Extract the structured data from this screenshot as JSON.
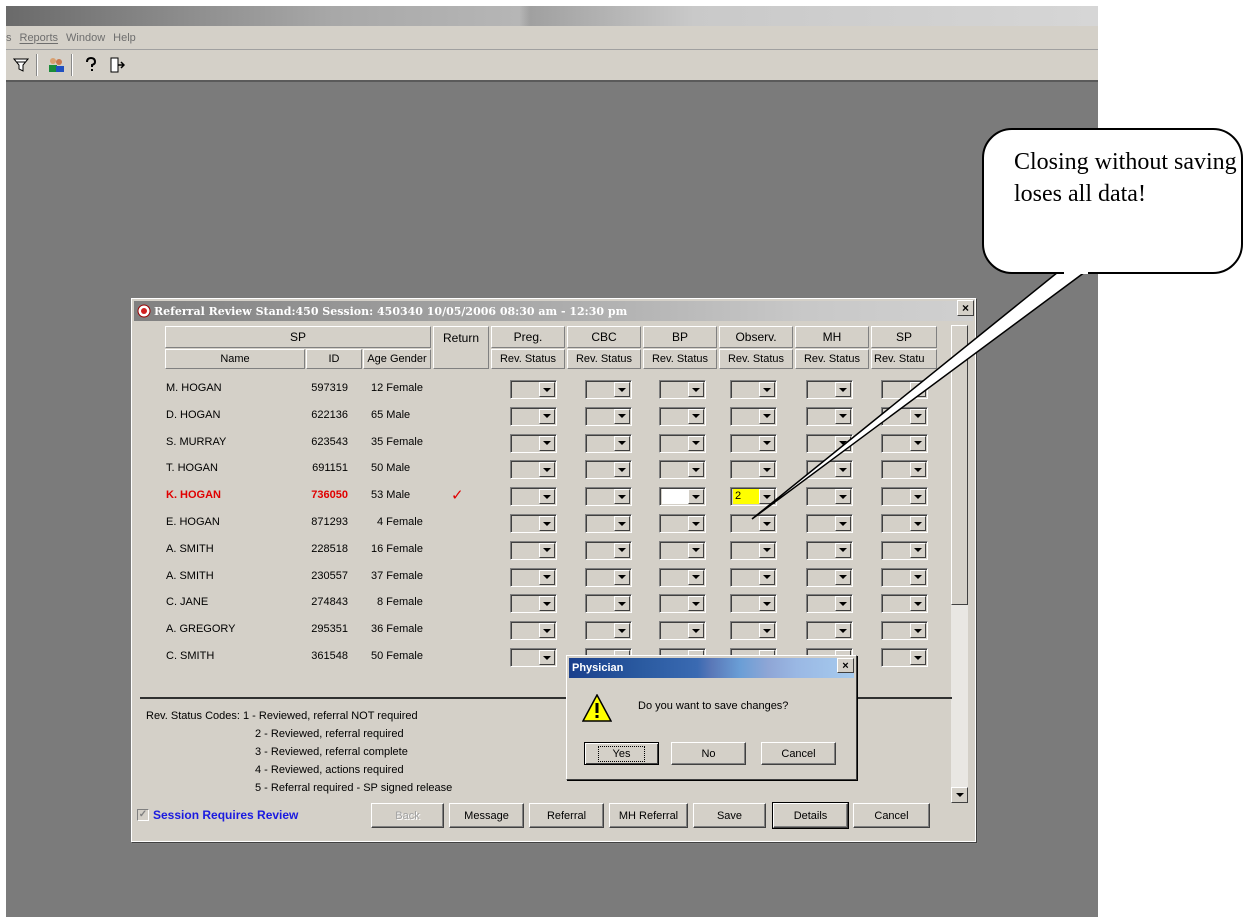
{
  "menubar": {
    "items": [
      "s",
      "Reports",
      "Window",
      "Help"
    ]
  },
  "toolbar": {
    "icons": [
      "filter-icon",
      "users-icon",
      "help-icon",
      "exit-icon"
    ]
  },
  "window": {
    "title": "Referral Review Stand:450 Session: 450340 10/05/2006 08:30 am - 12:30 pm",
    "close": "×",
    "headers": {
      "sp": "SP",
      "name": "Name",
      "id": "ID",
      "age_gender": "Age Gender",
      "return": "Return",
      "groups": [
        "Preg.",
        "CBC",
        "BP",
        "Observ.",
        "MH",
        "SP"
      ],
      "rev_status": [
        "Rev. Status",
        "Rev. Status",
        "Rev. Status",
        "Rev. Status",
        "Rev. Status",
        "Rev. Statu"
      ]
    },
    "rows": [
      {
        "name": "M. HOGAN",
        "id": "597319",
        "age_gender": "12 Female",
        "return": "",
        "values": [
          "",
          "",
          "",
          "",
          "",
          ""
        ]
      },
      {
        "name": "D. HOGAN",
        "id": "622136",
        "age_gender": "65 Male",
        "return": "",
        "values": [
          "",
          "",
          "",
          "",
          "",
          ""
        ]
      },
      {
        "name": "S. MURRAY",
        "id": "623543",
        "age_gender": "35 Female",
        "return": "",
        "values": [
          "",
          "",
          "",
          "",
          "",
          ""
        ]
      },
      {
        "name": "T. HOGAN",
        "id": "691151",
        "age_gender": "50 Male",
        "return": "",
        "values": [
          "",
          "",
          "",
          "",
          "",
          ""
        ]
      },
      {
        "name": "K. HOGAN",
        "id": "736050",
        "age_gender": "53 Male",
        "return": "✓",
        "values": [
          "",
          "",
          "",
          "2",
          "",
          ""
        ]
      },
      {
        "name": "E. HOGAN",
        "id": "871293",
        "age_gender": "4 Female",
        "return": "",
        "values": [
          "",
          "",
          "",
          "",
          "",
          ""
        ]
      },
      {
        "name": "A. SMITH",
        "id": "228518",
        "age_gender": "16 Female",
        "return": "",
        "values": [
          "",
          "",
          "",
          "",
          "",
          ""
        ]
      },
      {
        "name": "A. SMITH",
        "id": "230557",
        "age_gender": "37 Female",
        "return": "",
        "values": [
          "",
          "",
          "",
          "",
          "",
          ""
        ]
      },
      {
        "name": "C. JANE",
        "id": "274843",
        "age_gender": "8 Female",
        "return": "",
        "values": [
          "",
          "",
          "",
          "",
          "",
          ""
        ]
      },
      {
        "name": "A. GREGORY",
        "id": "295351",
        "age_gender": "36 Female",
        "return": "",
        "values": [
          "",
          "",
          "",
          "",
          "",
          ""
        ]
      },
      {
        "name": "C. SMITH",
        "id": "361548",
        "age_gender": "50 Female",
        "return": "",
        "values": [
          "",
          "",
          "",
          "",
          "",
          ""
        ]
      }
    ],
    "legend": [
      "Rev. Status Codes: 1 - Reviewed, referral NOT required",
      "2 - Reviewed, referral required",
      "3 - Reviewed, referral complete",
      "4 - Reviewed, actions required",
      "5 - Referral required - SP signed release"
    ],
    "session_review": "Session Requires Review",
    "buttons": [
      "Back",
      "Message",
      "Referral",
      "MH Referral",
      "Save",
      "Details",
      "Cancel"
    ]
  },
  "dialog": {
    "title": "Physician",
    "close": "×",
    "message": "Do you want to save changes?",
    "buttons": [
      "Yes",
      "No",
      "Cancel"
    ]
  },
  "callout": {
    "text": "Closing without saving loses all data!"
  },
  "colors": {
    "highlight_row": "#e00000",
    "session_review": "#1a1ae0",
    "selected_value_bg": "#ffff00"
  }
}
